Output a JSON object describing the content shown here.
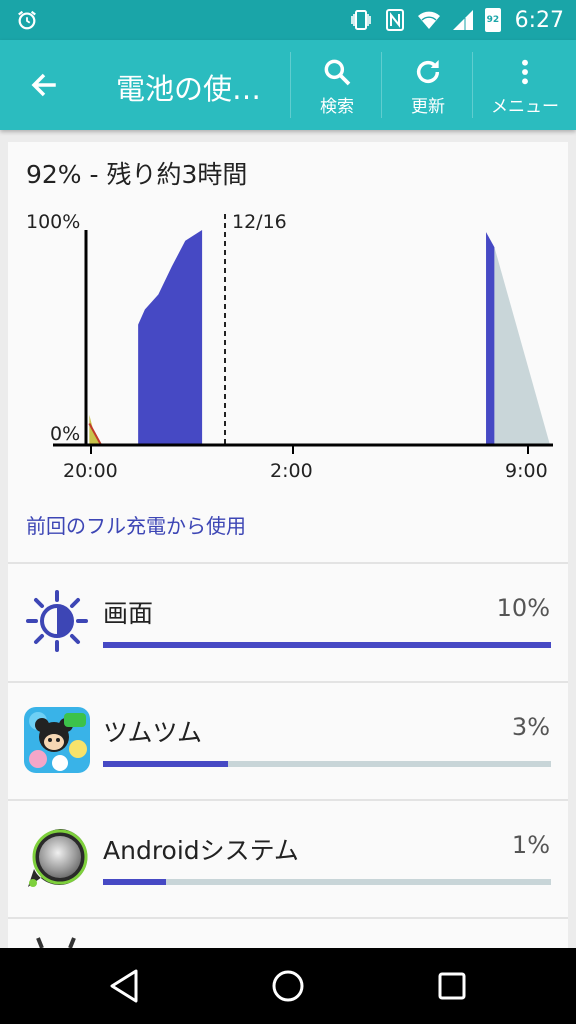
{
  "status_bar": {
    "time": "6:27",
    "battery_level": "92",
    "icons": [
      "alarm-icon",
      "vibrate-icon",
      "nfc-icon",
      "wifi-icon",
      "signal-icon",
      "battery-icon"
    ]
  },
  "toolbar": {
    "title": "電池の使…",
    "search_label": "検索",
    "refresh_label": "更新",
    "menu_label": "メニュー",
    "color": "#2bbcbf"
  },
  "summary": "92% - 残り約3時間",
  "chart_data": {
    "type": "area",
    "y_top_label": "100%",
    "y_bottom_label": "0%",
    "ylim": [
      0,
      100
    ],
    "x_tick_labels": [
      "20:00",
      "2:00",
      "9:00"
    ],
    "marker_label": "12/16",
    "series": [
      {
        "values_description": "",
        "segments": [
          {
            "x_start_hours": 20.0,
            "points": [
              [
                19.95,
                14
              ],
              [
                20.1,
                5
              ],
              [
                20.3,
                1
              ]
            ],
            "color": "#c9c24a"
          },
          {
            "x_start_hours": 21.4,
            "points": [
              [
                21.4,
                56
              ],
              [
                21.6,
                63
              ],
              [
                22.0,
                70
              ],
              [
                22.4,
                83
              ],
              [
                22.8,
                95
              ],
              [
                23.2,
                99
              ],
              [
                23.3,
                100
              ]
            ],
            "color": "#4649c4"
          },
          {
            "x_start_hours": 7.75,
            "points": [
              [
                7.75,
                99
              ],
              [
                8.0,
                92
              ]
            ],
            "color": "#4649c4"
          }
        ]
      }
    ],
    "projection": {
      "from": 92,
      "to": 0,
      "color": "#c9d6d9"
    },
    "colors": {
      "charged": "#4649c4",
      "projection": "#c9d6d9"
    }
  },
  "since_full_charge": "前回のフル充電から使用",
  "usage_items": [
    {
      "name": "画面",
      "percent": "10%",
      "fraction": 1.0,
      "icon": "brightness-icon"
    },
    {
      "name": "ツムツム",
      "percent": "3%",
      "fraction": 0.28,
      "icon": "tsum-tsum-app-icon"
    },
    {
      "name": "Androidシステム",
      "percent": "1%",
      "fraction": 0.14,
      "icon": "android-system-icon"
    }
  ],
  "nav_bar": {
    "buttons": [
      "back-icon",
      "home-icon",
      "recents-icon"
    ]
  }
}
